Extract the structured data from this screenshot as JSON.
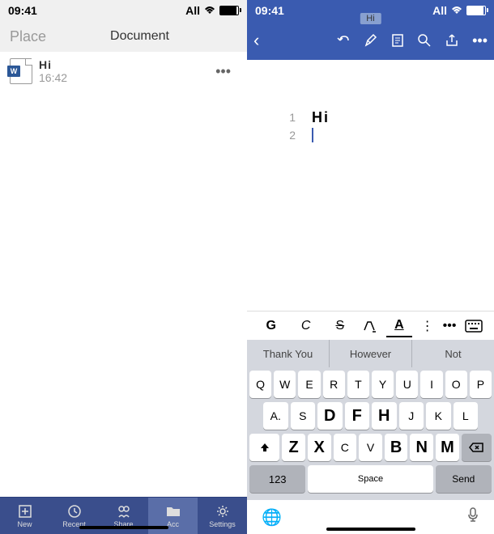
{
  "status": {
    "time": "09:41",
    "carrier": "All"
  },
  "left": {
    "place": "Place",
    "title": "Document",
    "file": {
      "name": "Hi",
      "time": "16:42"
    },
    "nav": {
      "new": "New",
      "recent": "Recent",
      "share": "Share",
      "acc": "Acc",
      "settings": "Settings"
    }
  },
  "right": {
    "badge": "Hi",
    "lines": {
      "l1": "1",
      "l2": "2",
      "text1": "Hi"
    },
    "format": {
      "bold": "G",
      "italic": "C",
      "strike": "S",
      "highlight": "A",
      "underline": "A"
    },
    "suggestions": {
      "s1": "Thank You",
      "s2": "However",
      "s3": "Not"
    },
    "keys": {
      "r1": [
        "Q",
        "W",
        "E",
        "R",
        "T",
        "Y",
        "U",
        "I",
        "O",
        "P"
      ],
      "r2": [
        "A.",
        "S",
        "D",
        "F",
        "H",
        "J",
        "K",
        "L"
      ],
      "r3": [
        "Z",
        "X",
        "C",
        "V",
        "B",
        "N",
        "M"
      ],
      "num": "123",
      "space": "Space",
      "send": "Send"
    }
  }
}
